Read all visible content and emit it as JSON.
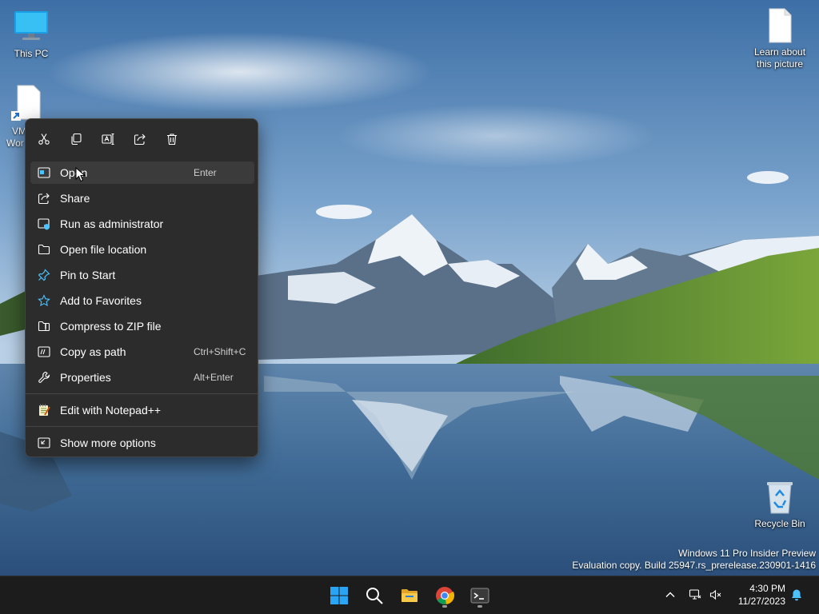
{
  "desktop": {
    "icons": [
      {
        "label": "This PC",
        "icon": "monitor-icon"
      },
      {
        "label": "Learn about this picture",
        "icon": "file-icon"
      },
      {
        "label": "Recycle Bin",
        "icon": "recycle-bin-icon"
      }
    ],
    "partial_shortcut": {
      "line1": "VM",
      "line2": "Wor",
      "icon": "file-shortcut-icon"
    }
  },
  "context_menu": {
    "quick_actions": [
      {
        "name": "cut",
        "icon": "scissors-icon"
      },
      {
        "name": "copy",
        "icon": "copy-icon"
      },
      {
        "name": "rename",
        "icon": "rename-icon"
      },
      {
        "name": "share",
        "icon": "share-icon"
      },
      {
        "name": "delete",
        "icon": "trash-icon"
      }
    ],
    "items": [
      {
        "label": "Open",
        "shortcut": "Enter",
        "icon": "open-window-icon"
      },
      {
        "label": "Share",
        "shortcut": "",
        "icon": "share-icon"
      },
      {
        "label": "Run as administrator",
        "shortcut": "",
        "icon": "admin-shield-icon"
      },
      {
        "label": "Open file location",
        "shortcut": "",
        "icon": "folder-icon"
      },
      {
        "label": "Pin to Start",
        "shortcut": "",
        "icon": "pin-icon"
      },
      {
        "label": "Add to Favorites",
        "shortcut": "",
        "icon": "star-icon"
      },
      {
        "label": "Compress to ZIP file",
        "shortcut": "",
        "icon": "zip-folder-icon"
      },
      {
        "label": "Copy as path",
        "shortcut": "Ctrl+Shift+C",
        "icon": "copy-path-icon"
      },
      {
        "label": "Properties",
        "shortcut": "Alt+Enter",
        "icon": "wrench-icon"
      },
      {
        "label": "Edit with Notepad++",
        "shortcut": "",
        "icon": "notepadpp-icon"
      },
      {
        "label": "Show more options",
        "shortcut": "",
        "icon": "more-options-icon"
      }
    ]
  },
  "watermark": {
    "line1": "Windows 11 Pro Insider Preview",
    "line2": "Evaluation copy. Build 25947.rs_prerelease.230901-1416"
  },
  "taskbar": {
    "apps": [
      {
        "name": "Start",
        "icon": "windows-logo-icon"
      },
      {
        "name": "Search",
        "icon": "search-icon"
      },
      {
        "name": "File Explorer",
        "icon": "file-explorer-icon"
      },
      {
        "name": "Google Chrome",
        "icon": "chrome-icon"
      },
      {
        "name": "Terminal",
        "icon": "terminal-icon"
      }
    ],
    "tray": {
      "icons": [
        "chevron-up-icon",
        "network-icon",
        "volume-muted-icon",
        "notification-bell-icon"
      ],
      "time": "4:30 PM",
      "date": "11/27/2023"
    }
  },
  "colors": {
    "menu_bg": "#2c2c2c",
    "menu_hover": "#3b3b3b",
    "taskbar_bg": "#1c1c1c",
    "accent": "#4cc2ff"
  }
}
